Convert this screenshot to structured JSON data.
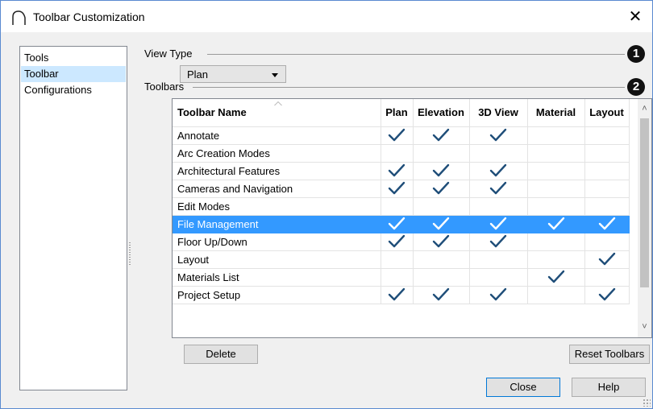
{
  "window": {
    "title": "Toolbar Customization",
    "close_symbol": "✕",
    "icon": "chief-architect-arch-icon"
  },
  "sidebar": {
    "items": [
      {
        "label": "Tools",
        "selected": false
      },
      {
        "label": "Toolbar",
        "selected": true
      },
      {
        "label": "Configurations",
        "selected": false
      }
    ]
  },
  "view_type": {
    "label": "View Type",
    "badge": "1",
    "selected": "Plan"
  },
  "toolbars": {
    "label": "Toolbars",
    "badge": "2",
    "columns": [
      "Toolbar Name",
      "Plan",
      "Elevation",
      "3D View",
      "Material",
      "Layout"
    ],
    "rows": [
      {
        "name": "Annotate",
        "checks": [
          true,
          true,
          true,
          false,
          false
        ],
        "selected": false
      },
      {
        "name": "Arc Creation Modes",
        "checks": [
          false,
          false,
          false,
          false,
          false
        ],
        "selected": false
      },
      {
        "name": "Architectural Features",
        "checks": [
          true,
          true,
          true,
          false,
          false
        ],
        "selected": false
      },
      {
        "name": "Cameras and Navigation",
        "checks": [
          true,
          true,
          true,
          false,
          false
        ],
        "selected": false
      },
      {
        "name": "Edit Modes",
        "checks": [
          false,
          false,
          false,
          false,
          false
        ],
        "selected": false
      },
      {
        "name": "File Management",
        "checks": [
          true,
          true,
          true,
          true,
          true
        ],
        "selected": true
      },
      {
        "name": "Floor Up/Down",
        "checks": [
          true,
          true,
          true,
          false,
          false
        ],
        "selected": false
      },
      {
        "name": "Layout",
        "checks": [
          false,
          false,
          false,
          false,
          true
        ],
        "selected": false
      },
      {
        "name": "Materials List",
        "checks": [
          false,
          false,
          false,
          true,
          false
        ],
        "selected": false
      },
      {
        "name": "Project Setup",
        "checks": [
          true,
          true,
          true,
          false,
          true
        ],
        "selected": false
      }
    ]
  },
  "buttons": {
    "delete": "Delete",
    "reset": "Reset Toolbars",
    "close": "Close",
    "help": "Help"
  },
  "colors": {
    "check": "#1f4e79",
    "check_selected": "#ffffff",
    "selection": "#3399ff"
  }
}
